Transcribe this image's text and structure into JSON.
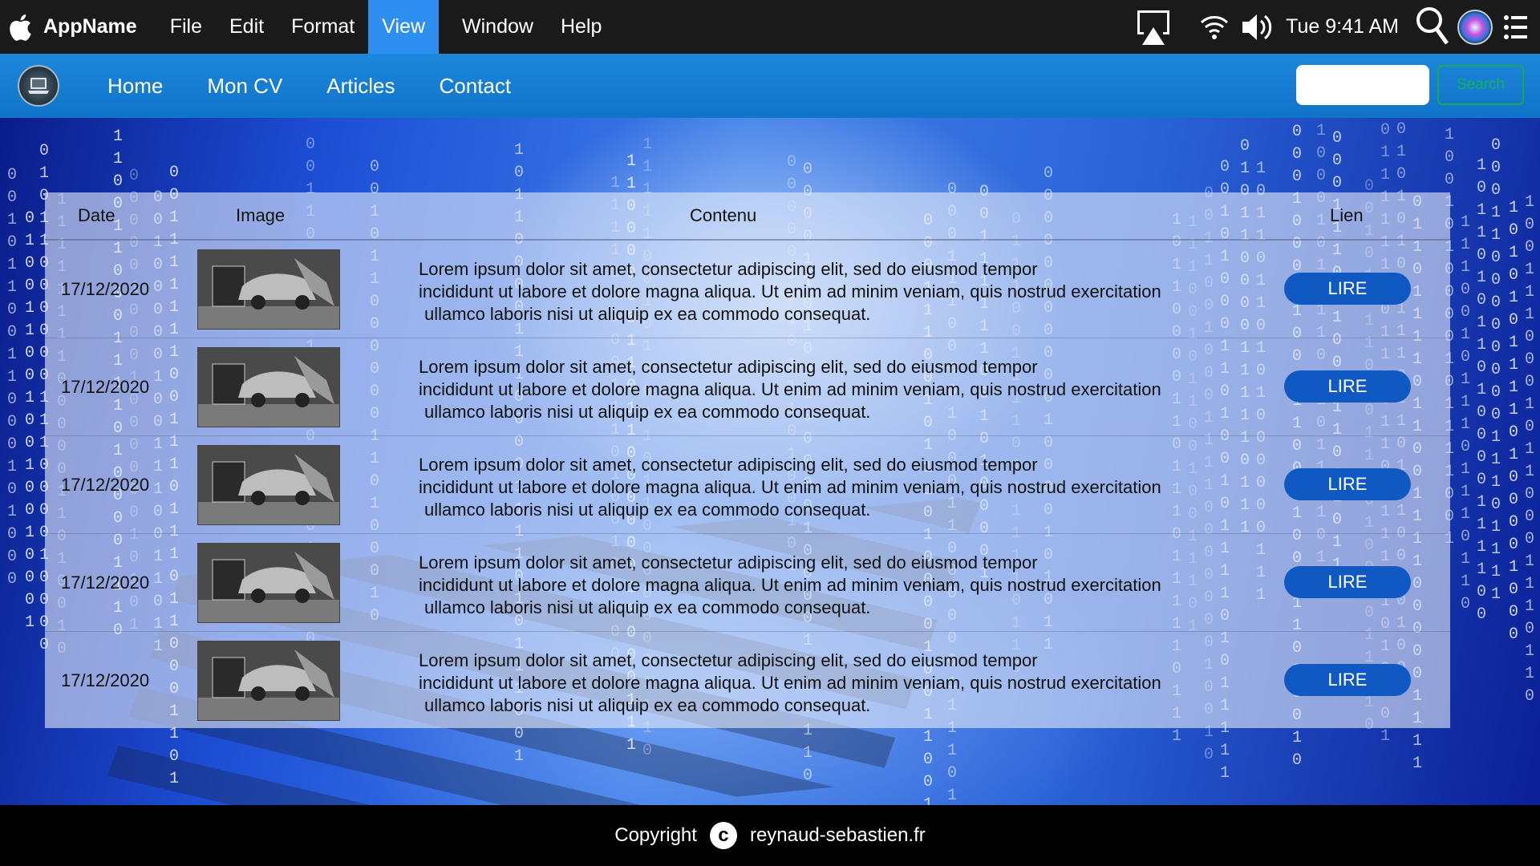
{
  "menubar": {
    "app_name": "AppName",
    "items": [
      "File",
      "Edit",
      "Format",
      "View",
      "Window",
      "Help"
    ],
    "active_item": "View",
    "clock": "Tue 9:41 AM",
    "icons": [
      "apple-icon",
      "airplay-icon",
      "wifi-icon",
      "volume-icon",
      "spotlight-search-icon",
      "siri-icon",
      "control-center-icon"
    ]
  },
  "nav": {
    "links": [
      "Home",
      "Mon CV",
      "Articles",
      "Contact"
    ],
    "search_placeholder": "",
    "search_button": "Search",
    "logo": "laptop-logo-icon"
  },
  "table": {
    "headers": {
      "date": "Date",
      "image": "Image",
      "content": "Contenu",
      "link": "Lien"
    },
    "rows": [
      {
        "date": "17/12/2020",
        "line1": "Lorem ipsum dolor sit amet, consectetur adipiscing elit, sed do eiusmod tempor",
        "line2": "incididunt ut labore et dolore magna aliqua. Ut enim ad minim veniam, quis nostrud exercitation",
        "line3": "ullamco laboris nisi ut aliquip ex ea commodo consequat.",
        "button": "LIRE"
      },
      {
        "date": "17/12/2020",
        "line1": "Lorem ipsum dolor sit amet, consectetur adipiscing elit, sed do eiusmod tempor",
        "line2": "incididunt ut labore et dolore magna aliqua. Ut enim ad minim veniam, quis nostrud exercitation",
        "line3": "ullamco laboris nisi ut aliquip ex ea commodo consequat.",
        "button": "LIRE"
      },
      {
        "date": "17/12/2020",
        "line1": "Lorem ipsum dolor sit amet, consectetur adipiscing elit, sed do eiusmod tempor",
        "line2": "incididunt ut labore et dolore magna aliqua. Ut enim ad minim veniam, quis nostrud exercitation",
        "line3": "ullamco laboris nisi ut aliquip ex ea commodo consequat.",
        "button": "LIRE"
      },
      {
        "date": "17/12/2020",
        "line1": "Lorem ipsum dolor sit amet, consectetur adipiscing elit, sed do eiusmod tempor",
        "line2": "incididunt ut labore et dolore magna aliqua. Ut enim ad minim veniam, quis nostrud exercitation",
        "line3": "ullamco laboris nisi ut aliquip ex ea commodo consequat.",
        "button": "LIRE"
      },
      {
        "date": "17/12/2020",
        "line1": "Lorem ipsum dolor sit amet, consectetur adipiscing elit, sed do eiusmod tempor",
        "line2": "incididunt ut labore et dolore magna aliqua. Ut enim ad minim veniam, quis nostrud exercitation",
        "line3": "ullamco laboris nisi ut aliquip ex ea commodo consequat.",
        "button": "LIRE"
      }
    ]
  },
  "footer": {
    "copyright": "Copyright",
    "copyright_symbol": "c",
    "site": "reynaud-sebastien.fr"
  },
  "colors": {
    "menubar_bg": "#1a1a1a",
    "menu_active": "#2f8ff0",
    "nav_bg": "#1d87dc",
    "button_bg": "#1059c2",
    "search_button_border": "#17a957"
  }
}
